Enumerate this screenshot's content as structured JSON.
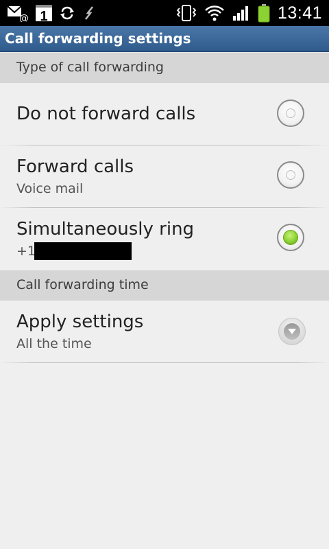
{
  "status_bar": {
    "time": "13:41",
    "icons_left": [
      "email-icon",
      "calendar-icon",
      "sync-icon",
      "usb-icon"
    ],
    "icons_right": [
      "vibrate-icon",
      "wifi-icon",
      "signal-icon",
      "battery-icon"
    ],
    "calendar_day": "1",
    "battery_color": "#8cd232"
  },
  "title_bar": {
    "title": "Call forwarding settings"
  },
  "sections": [
    {
      "header": "Type of call forwarding",
      "items": [
        {
          "label": "Do not forward calls",
          "sub": "",
          "selected": false
        },
        {
          "label": "Forward calls",
          "sub": "Voice mail",
          "selected": false
        },
        {
          "label": "Simultaneously ring",
          "sub": "+1",
          "selected": true
        }
      ]
    },
    {
      "header": "Call forwarding time",
      "items": [
        {
          "label": "Apply settings",
          "sub": "All the time",
          "control": "dropdown"
        }
      ]
    }
  ],
  "colors": {
    "title_bar": "#3b6696",
    "radio_checked": "#8cd232",
    "section_header_bg": "#d6d6d6",
    "page_bg": "#efefef"
  }
}
